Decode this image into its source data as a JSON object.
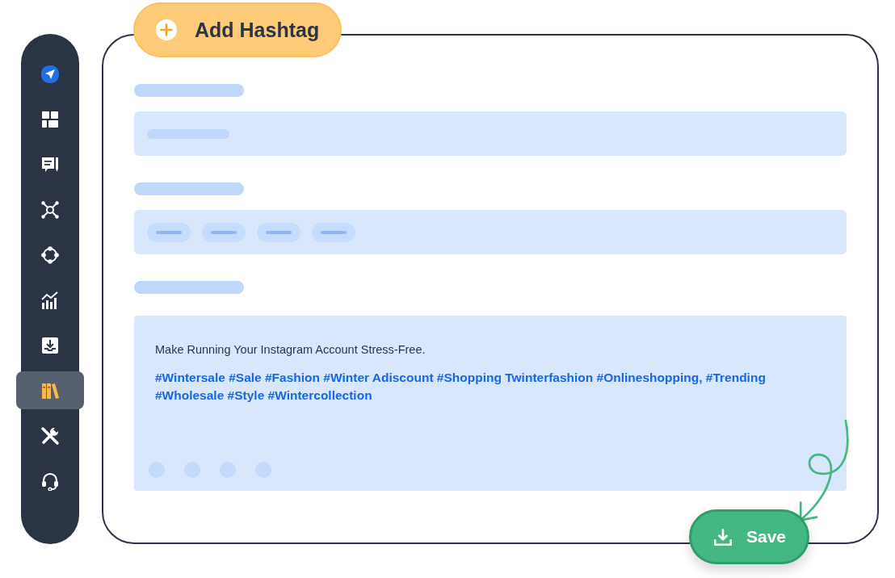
{
  "sidebar": {
    "items": [
      {
        "selected": false
      },
      {
        "selected": false
      },
      {
        "selected": false
      },
      {
        "selected": false
      },
      {
        "selected": false
      },
      {
        "selected": false
      },
      {
        "selected": false
      },
      {
        "selected": true
      },
      {
        "selected": false
      },
      {
        "selected": false
      }
    ]
  },
  "add_button": {
    "label": "Add Hashtag"
  },
  "post": {
    "caption": "Make Running Your Instagram Account Stress-Free.",
    "hashtags": "#Wintersale #Sale #Fashion #Winter Adiscount #Shopping Twinterfashion #Onlineshopping, #Trending #Wholesale #Style #Wintercollection"
  },
  "save_button": {
    "label": "Save"
  }
}
